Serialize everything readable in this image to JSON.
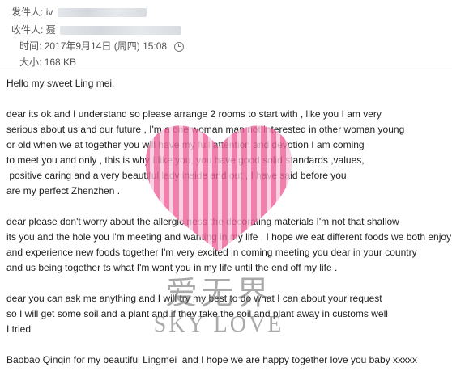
{
  "header": {
    "from_label": "发件人:",
    "from_value": "iv",
    "to_label": "收件人:",
    "to_value": "聂",
    "time_label": "时间:",
    "time_value": "2017年9月14日 (周四) 15:08",
    "size_label": "大小:",
    "size_value": "168 KB"
  },
  "email": {
    "lines": [
      "Hello my sweet Ling mei.",
      "",
      "dear its ok and I understand so please arrange 2 rooms to start with , like you I am very",
      "serious about us and our future , I'm a one woman man not interested in other woman young",
      "or old when we at together you will have my full attention and devotion I am coming",
      "to meet you and only , this is why I like you, you have good solid standards ,values,",
      " positive caring and a very beautiful lady inside and out , I have said before you",
      "are my perfect Zhenzhen .",
      "",
      "dear please don't worry about the allergic ness the decorating materials I'm not that shallow",
      "its you and the hole you I'm meeting and wanting in my life , I hope we eat different foods we both enjoy",
      "and experience new foods together I'm very excited in coming meeting you dear in your country",
      "and us being together ts what I'm want you in my life until the end off my life .",
      "",
      "dear you can ask me anything and I will try my best to do what I can about your request",
      "so I will get some soil and a plant and if they take the soil and plant away in customs well",
      "I tried",
      "",
      "Baobao Qinqin for my beautiful Lingmei  and I hope we are happy together love you baby xxxxx"
    ]
  },
  "watermark": {
    "cn_text": "爱无界",
    "en_text": "SKY LOVE",
    "color": "#f06aa0"
  }
}
